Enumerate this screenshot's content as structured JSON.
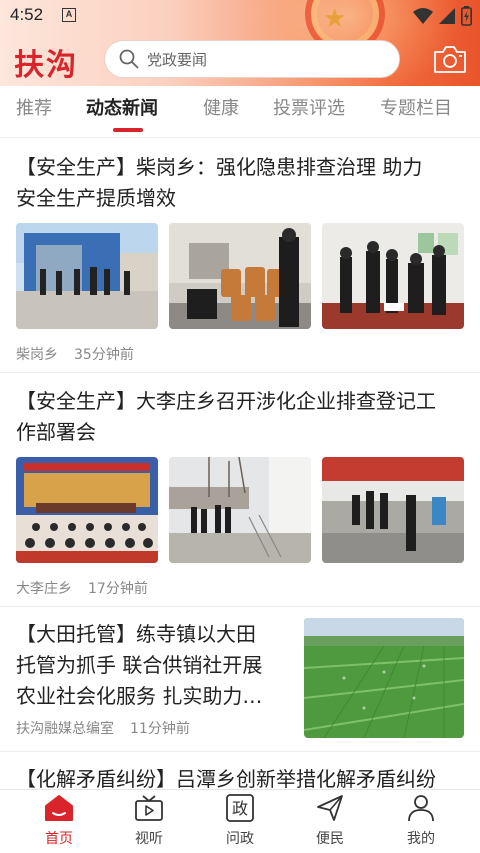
{
  "status_bar": {
    "time": "4:52",
    "notification_letter": "A"
  },
  "app": {
    "logo_text": "扶沟"
  },
  "search": {
    "placeholder": "党政要闻"
  },
  "tabs": [
    {
      "label": "推荐"
    },
    {
      "label": "动态新闻",
      "active": true
    },
    {
      "label": "健康"
    },
    {
      "label": "投票评选"
    },
    {
      "label": "专题栏目"
    }
  ],
  "articles": [
    {
      "title_line1": "【安全生产】柴岗乡：强化隐患排查治理 助力",
      "title_line2": "安全生产提质增效",
      "source": "柴岗乡",
      "time": "35分钟前"
    },
    {
      "title_line1": "【安全生产】大李庄乡召开涉化企业排查登记工",
      "title_line2": "作部署会",
      "source": "大李庄乡",
      "time": "17分钟前"
    },
    {
      "title_line1": "【大田托管】练寺镇以大田",
      "title_line2": "托管为抓手 联合供销社开展",
      "title_line3": "农业社会化服务 扎实助力…",
      "source": "扶沟融媒总编室",
      "time": "11分钟前"
    },
    {
      "title_line1": "【化解矛盾纠纷】吕潭乡创新举措化解矛盾纠纷"
    }
  ],
  "bottom_nav": [
    {
      "label": "首页",
      "active": true,
      "icon": "home-icon"
    },
    {
      "label": "视听",
      "icon": "tv-icon"
    },
    {
      "label": "问政",
      "icon": "zheng-icon",
      "icon_char": "政"
    },
    {
      "label": "便民",
      "icon": "send-icon"
    },
    {
      "label": "我的",
      "icon": "user-icon"
    }
  ],
  "colors": {
    "accent": "#d8242a",
    "header_start": "#fde6dc",
    "header_end": "#e9552c"
  }
}
